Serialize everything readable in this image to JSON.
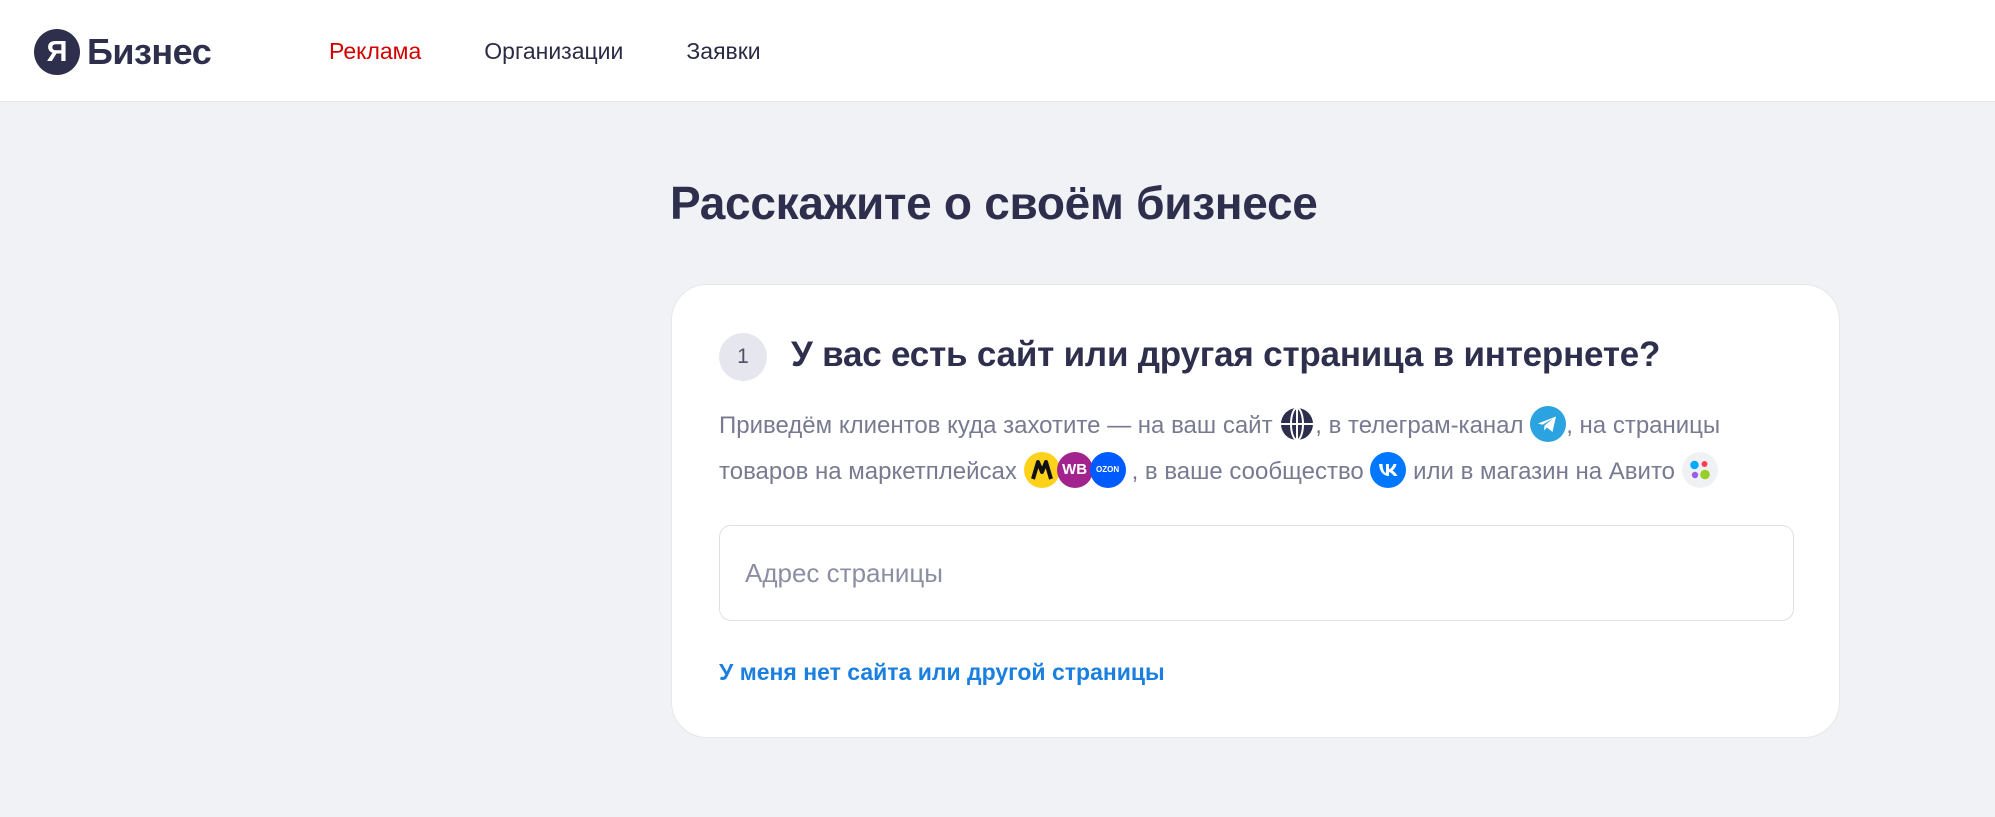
{
  "header": {
    "logo_letter": "Я",
    "logo_text": "Бизнес",
    "nav": [
      {
        "label": "Реклама",
        "active": true
      },
      {
        "label": "Организации",
        "active": false
      },
      {
        "label": "Заявки",
        "active": false
      }
    ]
  },
  "main": {
    "title": "Расскажите о своём бизнесе",
    "step": {
      "number": "1",
      "question": "У вас есть сайт или другая страница в интернете?",
      "description": {
        "part1": "Приведём клиентов куда захотите — на ваш сайт",
        "part2": ", в телеграм-канал",
        "part3": ", на страницы товаров на маркетплейсах",
        "part4": ", в ваше сообщество",
        "part5": "или в магазин на Авито"
      },
      "icons": [
        "globe-icon",
        "telegram-icon",
        "yandex-market-icon",
        "wildberries-icon",
        "ozon-icon",
        "vk-icon",
        "avito-icon"
      ],
      "marketplace_labels": {
        "wb": "WB",
        "ozon": "OZON"
      },
      "input": {
        "placeholder": "Адрес страницы",
        "value": ""
      },
      "no_site_link": "У меня нет сайта или другой страницы"
    }
  },
  "colors": {
    "accent_red": "#d40000",
    "link_blue": "#1a7fde",
    "background": "#f1f2f6",
    "text_dark": "#2d2f4d"
  }
}
